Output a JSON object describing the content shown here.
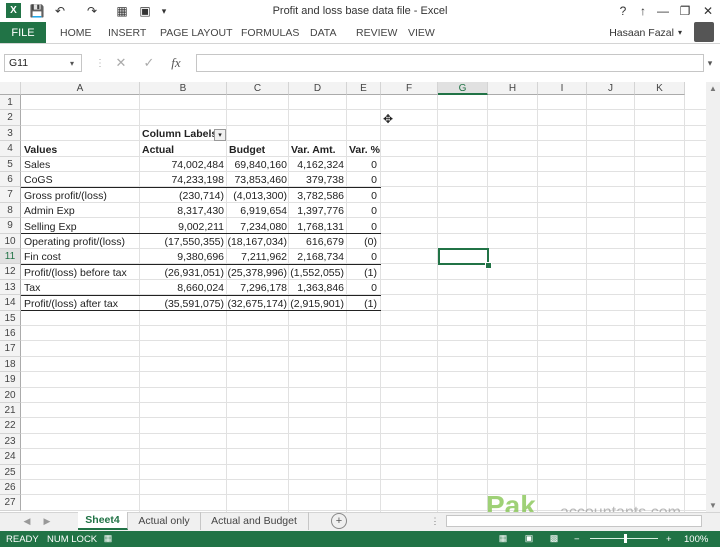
{
  "window": {
    "title": "Profit and loss base data file - Excel",
    "app_icon": "X",
    "qat": [
      "save-icon",
      "undo-icon",
      "redo-icon",
      "table-icon",
      "picture-icon",
      "customize-qat-icon"
    ],
    "controls": [
      "?",
      "↑",
      "—",
      "❐",
      "✕"
    ]
  },
  "ribbon": {
    "file": "FILE",
    "tabs": [
      "HOME",
      "INSERT",
      "PAGE LAYOUT",
      "FORMULAS",
      "DATA",
      "REVIEW",
      "VIEW"
    ],
    "user": "Hasaan Fazal"
  },
  "formula_bar": {
    "name_box": "G11",
    "cancel": "✕",
    "enter": "✓",
    "fx": "fx",
    "value": ""
  },
  "grid": {
    "columns": [
      "A",
      "B",
      "C",
      "D",
      "E",
      "F",
      "G",
      "H",
      "I",
      "J",
      "K"
    ],
    "rows": [
      "1",
      "2",
      "3",
      "4",
      "5",
      "6",
      "7",
      "8",
      "9",
      "10",
      "11",
      "12",
      "13",
      "14",
      "15",
      "16",
      "17",
      "18",
      "19",
      "20",
      "21",
      "22",
      "23",
      "24",
      "25",
      "26",
      "27"
    ],
    "selected_cell": "G11",
    "pivot": {
      "column_labels": "Column Labels",
      "headers": [
        "Values",
        "Actual",
        "Budget",
        "Var. Amt.",
        "Var. %"
      ],
      "rows": [
        [
          "Sales",
          "74,002,484",
          "69,840,160",
          "4,162,324",
          "0"
        ],
        [
          "CoGS",
          "74,233,198",
          "73,853,460",
          "379,738",
          "0"
        ],
        [
          "Gross profit/(loss)",
          "(230,714)",
          "(4,013,300)",
          "3,782,586",
          "0"
        ],
        [
          "Admin Exp",
          "8,317,430",
          "6,919,654",
          "1,397,776",
          "0"
        ],
        [
          "Selling Exp",
          "9,002,211",
          "7,234,080",
          "1,768,131",
          "0"
        ],
        [
          "Operating profit/(loss)",
          "(17,550,355)",
          "(18,167,034)",
          "616,679",
          "(0)"
        ],
        [
          "Fin cost",
          "9,380,696",
          "7,211,962",
          "2,168,734",
          "0"
        ],
        [
          "Profit/(loss) before tax",
          "(26,931,051)",
          "(25,378,996)",
          "(1,552,055)",
          "(1)"
        ],
        [
          "Tax",
          "8,660,024",
          "7,296,178",
          "1,363,846",
          "0"
        ],
        [
          "Profit/(loss) after tax",
          "(35,591,075)",
          "(32,675,174)",
          "(2,915,901)",
          "(1)"
        ]
      ]
    }
  },
  "sheets": {
    "tabs": [
      "Sheet4",
      "Actual only",
      "Actual and Budget"
    ],
    "active": "Sheet4",
    "add": "+"
  },
  "watermark": {
    "pak": "Pak",
    "rest": "accountants.com"
  },
  "status": {
    "ready": "READY",
    "numlock": "NUM LOCK",
    "zoom": "100%",
    "zoom_out": "−",
    "zoom_in": "+"
  }
}
